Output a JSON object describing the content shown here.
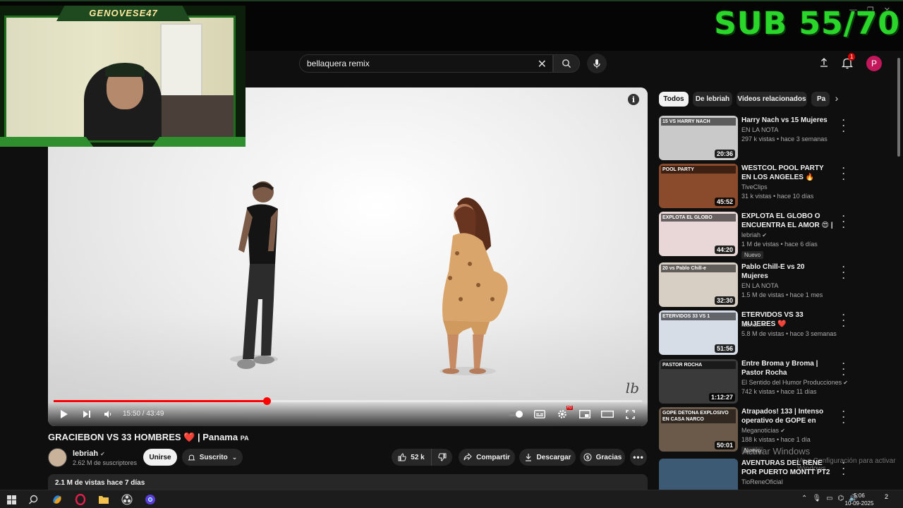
{
  "stream_overlay": {
    "streamer_name": "GENOVESE47",
    "sub_goal": "SUB 55/70"
  },
  "header": {
    "search_value": "bellaquera remix",
    "notification_count": "1",
    "avatar_letter": "P"
  },
  "player": {
    "time_display": "15:50 / 43:49",
    "progress": 0.362,
    "hd_badge": "HD",
    "watermark": "lb"
  },
  "video": {
    "title_prefix": "GRACIEBON VS 33 HOMBRES",
    "title_heart": "❤️",
    "title_suffix": "| Panama",
    "title_flag": "PA",
    "channel_name": "lebriah",
    "subscribers": "2.62 M de suscriptores",
    "join_label": "Unirse",
    "subscribed_label": "Suscrito",
    "like_count": "52 k",
    "share_label": "Compartir",
    "download_label": "Descargar",
    "thanks_label": "Gracias",
    "views_date": "2.1 M de vistas  hace 7 días"
  },
  "sidebar": {
    "chips": [
      "Todos",
      "De lebriah",
      "Videos relacionados",
      "Pa"
    ],
    "recommendations": [
      {
        "title": "Harry Nach vs 15 Mujeres",
        "channel": "EN LA NOTA",
        "verified": false,
        "meta": "297 k vistas • hace 3 semanas",
        "duration": "20:36",
        "badge": "",
        "thumb_color": "#c9c9c9",
        "thumb_text": "15 VS HARRY NACH"
      },
      {
        "title": "WESTCOL POOL PARTY EN LOS ANGELES 🔥",
        "channel": "TiveClips",
        "verified": false,
        "meta": "31 k vistas • hace 10 días",
        "duration": "45:52",
        "badge": "",
        "thumb_color": "#8a4b2c",
        "thumb_text": "POOL PARTY"
      },
      {
        "title": "EXPLOTA EL GLOBO O ENCUENTRA EL AMOR 😍 | ...",
        "channel": "lebriah",
        "verified": true,
        "meta": "1 M de vistas • hace 6 días",
        "duration": "44:20",
        "badge": "Nuevo",
        "thumb_color": "#e9d7d7",
        "thumb_text": "EXPLOTA EL GLOBO"
      },
      {
        "title": "Pablo Chill-E vs 20 Mujeres",
        "channel": "EN LA NOTA",
        "verified": false,
        "meta": "1.5 M de vistas • hace 1 mes",
        "duration": "32:30",
        "badge": "",
        "thumb_color": "#d8cfc4",
        "thumb_text": "20 vs Pablo Chill-e"
      },
      {
        "title": "ETERVIDOS VS 33 MUJERES ❤️",
        "channel": "lebriah",
        "verified": true,
        "meta": "5.8 M de vistas • hace 3 semanas",
        "duration": "51:56",
        "badge": "",
        "thumb_color": "#d7dde6",
        "thumb_text": "ETERVIDOS 33 VS 1"
      },
      {
        "title": "Entre Broma y Broma | Pastor Rocha",
        "channel": "El Sentido del Humor Producciones",
        "verified": true,
        "meta": "742 k vistas • hace 11 días",
        "duration": "1:12:27",
        "badge": "",
        "thumb_color": "#3a3a3a",
        "thumb_text": "PASTOR ROCHA"
      },
      {
        "title": "Atrapados! 133 | Intenso operativo de GOPE en Melipill...",
        "channel": "Meganoticias",
        "verified": true,
        "meta": "188 k vistas • hace 1 día",
        "duration": "50:01",
        "badge": "Nuevo",
        "thumb_color": "#6b5a4a",
        "thumb_text": "GOPE DETONA EXPLOSIVO EN CASA NARCO"
      },
      {
        "title": "AVENTURAS DEL RENE POR PUERTO MONTT PT2 😂",
        "channel": "TioReneOficial",
        "verified": false,
        "meta": "",
        "duration": "",
        "badge": "",
        "thumb_color": "#3d5a74",
        "thumb_text": ""
      }
    ]
  },
  "os": {
    "activate_title": "Activar Windows",
    "activate_sub": "Ve a Configuración para activar Windows.",
    "time": "5:06",
    "date": "10-09-2025",
    "notifications": "2"
  },
  "colors": {
    "accent_red": "#ff0000",
    "overlay_green": "#2bd62b",
    "background": "#0f0f0f"
  }
}
